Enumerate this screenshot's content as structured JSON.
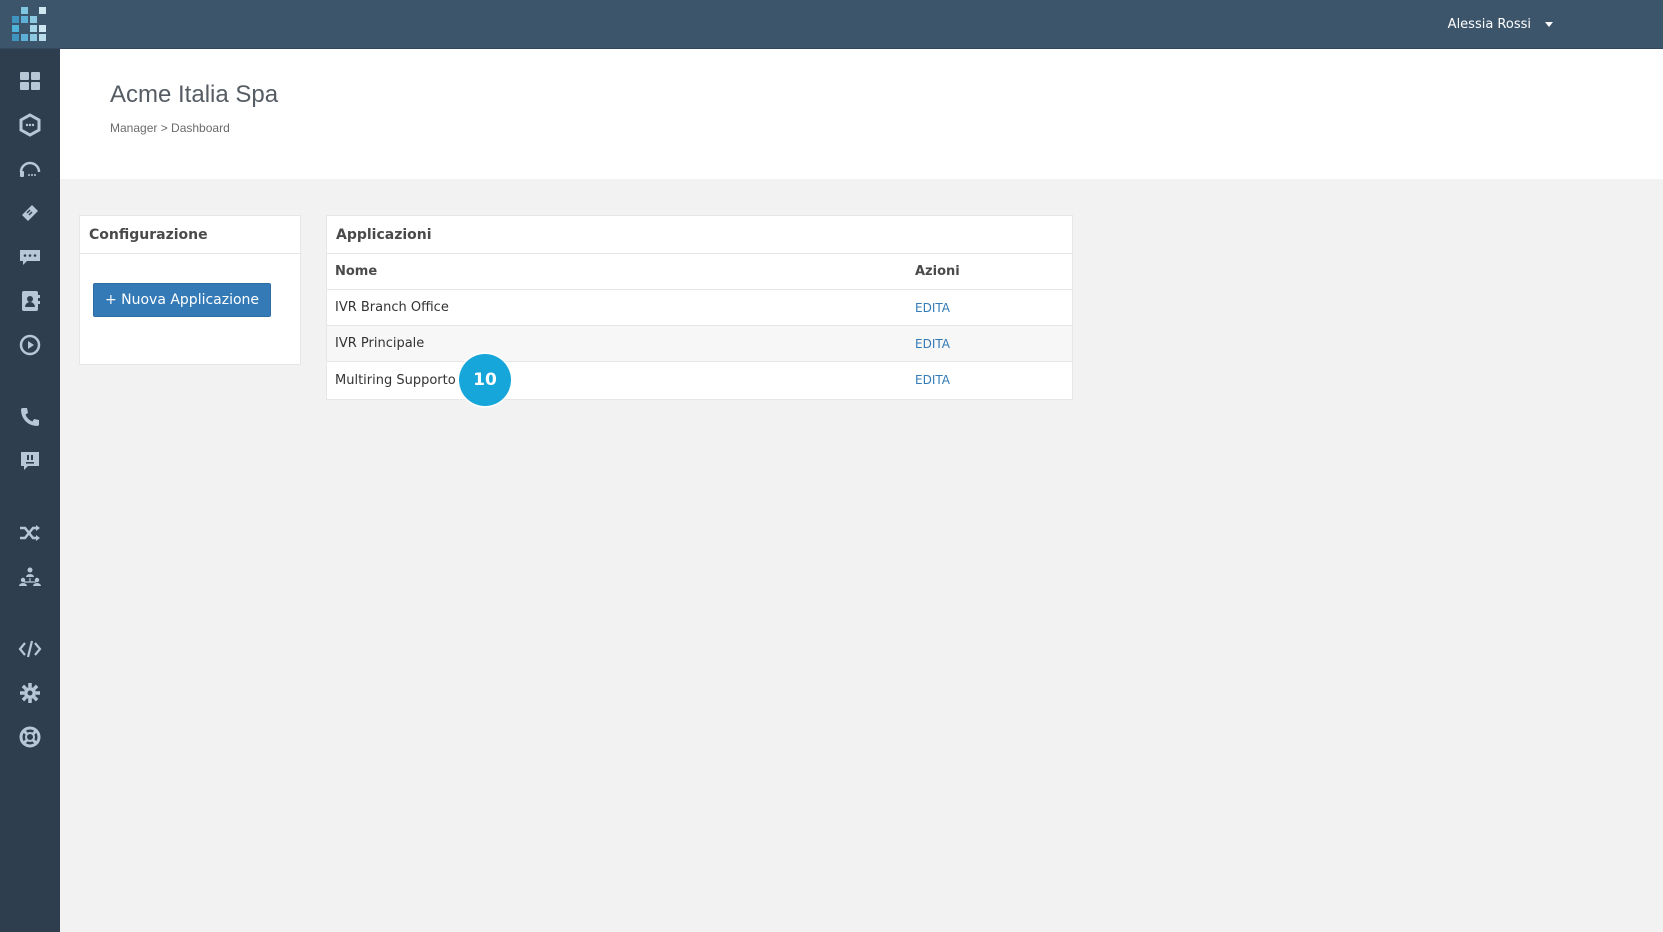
{
  "topbar": {
    "user_name": "Alessia Rossi",
    "logo_colors": [
      "#4fb3d9",
      "#7fc6e0",
      "#a6d6e8",
      "#cfe7f0",
      "#3f95c0",
      "#5fb0d6",
      "#8cc8e1",
      "#b9dcea"
    ]
  },
  "sidebar": {
    "icons": [
      "dashboard-grid-icon",
      "hexagon-chat-icon",
      "headset-icon",
      "ticket-icon",
      "message-bubble-icon",
      "contacts-book-icon",
      "play-circle-icon",
      "phone-icon",
      "chat-alert-icon",
      "shuffle-icon",
      "org-chart-icon",
      "code-icon",
      "gear-icon",
      "lifebuoy-icon"
    ],
    "icon_color": "#b8c7d6"
  },
  "header": {
    "title": "Acme Italia Spa",
    "breadcrumb": "Manager > Dashboard"
  },
  "config_panel": {
    "heading": "Configurazione",
    "new_button_label": "+ Nuova Applicazione"
  },
  "apps_panel": {
    "heading": "Applicazioni",
    "columns": [
      "Nome",
      "Azioni"
    ],
    "rows": [
      {
        "name": "IVR Branch Office",
        "action": "EDITA"
      },
      {
        "name": "IVR Principale",
        "action": "EDITA"
      },
      {
        "name": "Multiring Supporto",
        "action": "EDITA"
      }
    ]
  },
  "step_badge": "10",
  "colors": {
    "topbar": "#3d556b",
    "sidebar": "#2e3e4e",
    "primary": "#337ab7",
    "badge": "#16a6d9"
  }
}
